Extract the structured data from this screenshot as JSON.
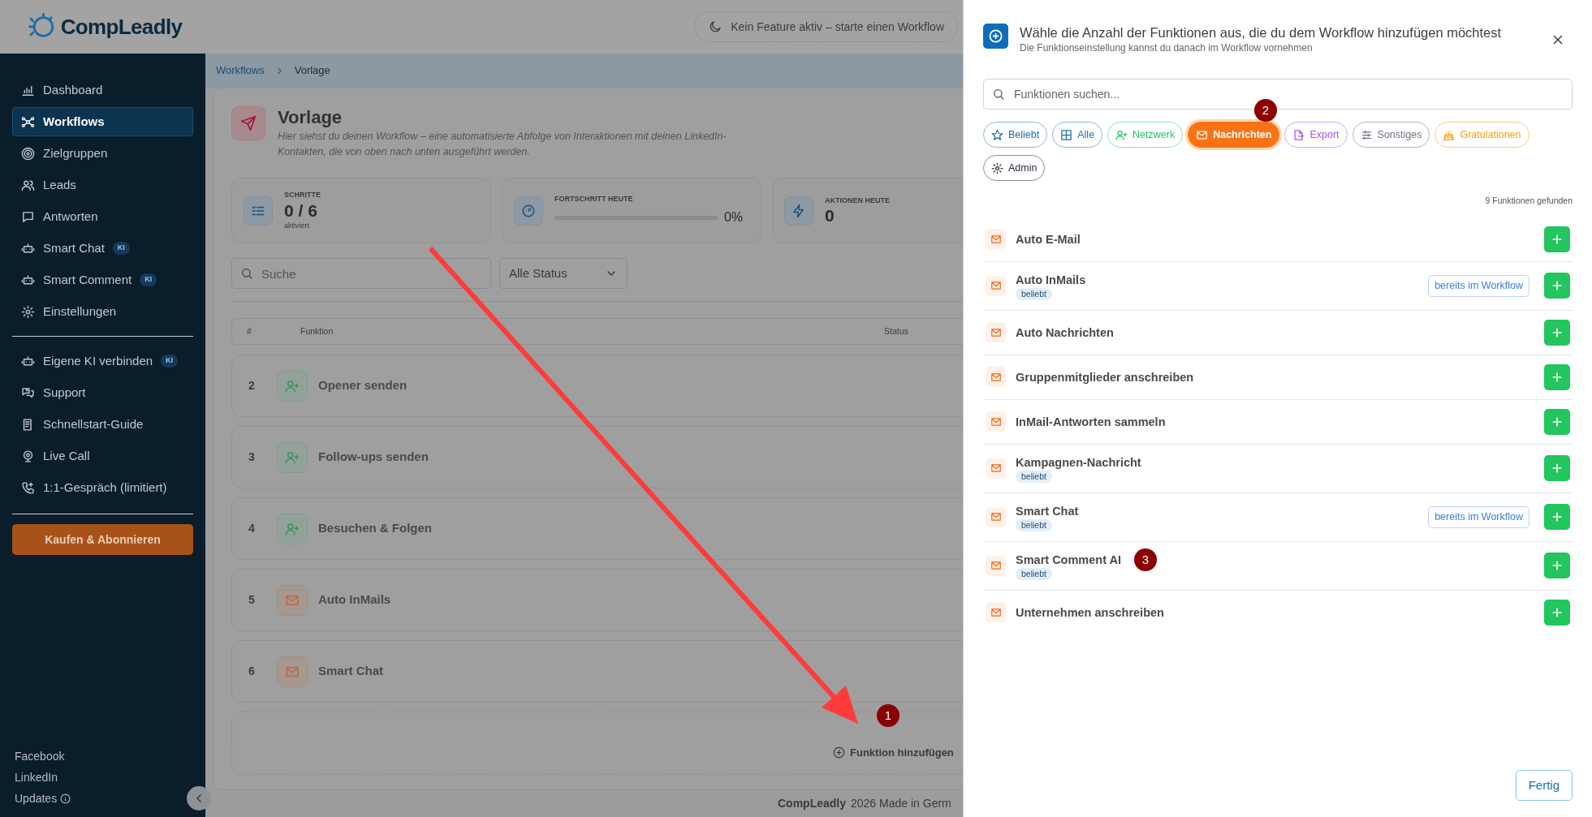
{
  "header": {
    "logo": "CompLeadly",
    "status_pill": "Kein Feature aktiv – starte einen Workflow"
  },
  "sidebar": {
    "items": [
      {
        "label": "Dashboard",
        "selected": false
      },
      {
        "label": "Workflows",
        "selected": true
      },
      {
        "label": "Zielgruppen",
        "selected": false
      },
      {
        "label": "Leads",
        "selected": false
      },
      {
        "label": "Antworten",
        "selected": false
      },
      {
        "label": "Smart Chat",
        "badge": "KI",
        "selected": false
      },
      {
        "label": "Smart Comment",
        "badge": "KI",
        "selected": false
      },
      {
        "label": "Einstellungen",
        "selected": false
      }
    ],
    "tools": [
      {
        "label": "Eigene KI verbinden",
        "badge": "KI",
        "selected": false
      },
      {
        "label": "Support",
        "selected": false
      },
      {
        "label": "Schnellstart-Guide",
        "selected": false
      },
      {
        "label": "Live Call",
        "selected": false
      },
      {
        "label": "1:1-Gespräch (limitiert)",
        "selected": false
      }
    ],
    "cta": "Kaufen & Abonnieren",
    "footer_links": [
      "Facebook",
      "LinkedIn",
      "Updates"
    ]
  },
  "breadcrumb": [
    "Workflows",
    "Vorlage"
  ],
  "page": {
    "title": "Vorlage",
    "description": "Hier siehst du deinen Workflow – eine automatisierte Abfolge von Interaktionen mit deinen LinkedIn-Kontakten, die von oben nach unten ausgeführt werden."
  },
  "stats": [
    {
      "kind": "count",
      "label": "SCHRITTE",
      "value": "0 / 6",
      "note": "aktiviert"
    },
    {
      "kind": "progress",
      "label": "FORTSCHRITT HEUTE",
      "level": 0,
      "reading": "0%"
    },
    {
      "kind": "count",
      "label": "AKTIONEN HEUTE",
      "value": "0"
    }
  ],
  "filters": {
    "search_placeholder": "Suche",
    "status_select": "Alle Status"
  },
  "table": {
    "columns": [
      "#",
      "Funktion",
      "Status"
    ],
    "rows": [
      {
        "number": "2",
        "name": "Opener senden",
        "kind": "network"
      },
      {
        "number": "3",
        "name": "Follow-ups senden",
        "kind": "network"
      },
      {
        "number": "4",
        "name": "Besuchen & Folgen",
        "kind": "network"
      },
      {
        "number": "5",
        "name": "Auto InMails",
        "kind": "message"
      },
      {
        "number": "6",
        "name": "Smart Chat",
        "kind": "message"
      }
    ],
    "add_label": "Funktion hinzufügen"
  },
  "footer": {
    "brand": "CompLeadly",
    "text": "2026 Made in Germ"
  },
  "panel": {
    "title": "Wähle die Anzahl der Funktionen aus, die du dem Workflow hinzufügen möchtest",
    "subtitle": "Die Funktionseinstellung kannst du danach im Workflow vornehmen",
    "search_placeholder": "Funktionen suchen...",
    "categories": [
      {
        "label": "Beliebt",
        "color": "#1d6fa5",
        "selected": false
      },
      {
        "label": "Alle",
        "color": "#1d6fa5",
        "selected": false
      },
      {
        "label": "Netzwerk",
        "color": "#22c55e",
        "selected": false
      },
      {
        "label": "Nachrichten",
        "color": "#f97316",
        "selected": true
      },
      {
        "label": "Export",
        "color": "#a855f7",
        "selected": false
      },
      {
        "label": "Sonstiges",
        "color": "#6b7280",
        "selected": false
      },
      {
        "label": "Gratulationen",
        "color": "#f59e0b",
        "selected": false
      },
      {
        "label": "Admin",
        "color": "#1f2937",
        "selected": false
      }
    ],
    "result_count": "9 Funktionen gefunden",
    "functions": [
      {
        "name": "Auto E-Mail"
      },
      {
        "name": "Auto InMails",
        "badge": "beliebt",
        "status": "bereits im Workflow"
      },
      {
        "name": "Auto Nachrichten"
      },
      {
        "name": "Gruppenmitglieder anschreiben"
      },
      {
        "name": "InMail-Antworten sammeln"
      },
      {
        "name": "Kampagnen-Nachricht",
        "badge": "beliebt"
      },
      {
        "name": "Smart Chat",
        "badge": "beliebt",
        "status": "bereits im Workflow"
      },
      {
        "name": "Smart Comment AI",
        "badge": "beliebt"
      },
      {
        "name": "Unternehmen anschreiben"
      }
    ],
    "done_button": "Fertig"
  },
  "annotations": [
    {
      "label": "1"
    },
    {
      "label": "2"
    },
    {
      "label": "3"
    }
  ]
}
